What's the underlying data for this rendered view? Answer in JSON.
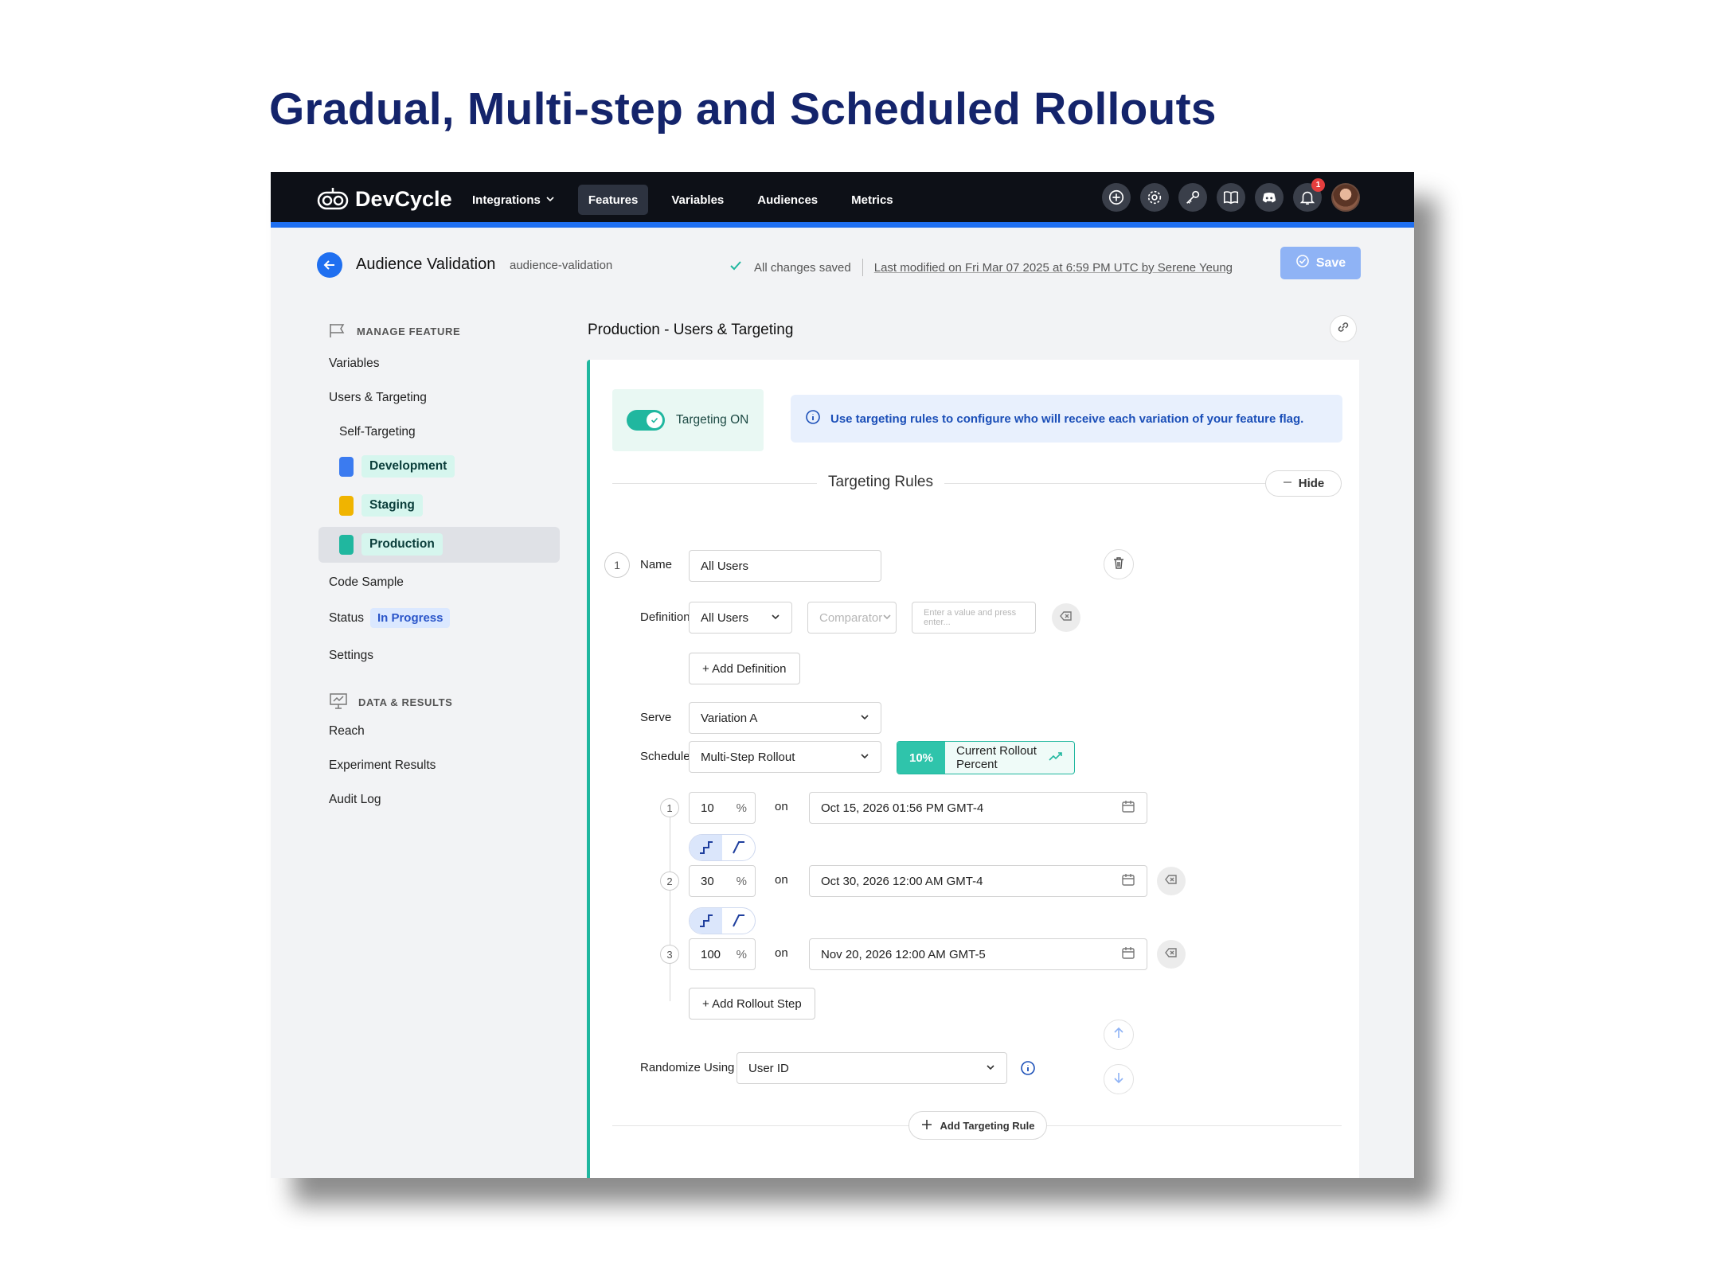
{
  "slide_title": "Gradual, Multi-step and Scheduled Rollouts",
  "app": {
    "logo_text": "DevCycle",
    "nav": [
      {
        "label": "Integrations",
        "active": false,
        "dropdown": true
      },
      {
        "label": "Features",
        "active": true
      },
      {
        "label": "Variables",
        "active": false
      },
      {
        "label": "Audiences",
        "active": false
      },
      {
        "label": "Metrics",
        "active": false
      }
    ],
    "top_icons": [
      "plus-circle-icon",
      "gear-icon",
      "key-icon",
      "book-icon",
      "discord-icon",
      "bell-icon"
    ],
    "notification_count": "1",
    "accent_color": "#1f6ff0",
    "brand_teal": "#20b79f"
  },
  "header": {
    "feature_name": "Audience Validation",
    "feature_key": "audience-validation",
    "saved_status": "All changes saved",
    "last_modified": "Last modified on Fri Mar 07 2025 at 6:59 PM UTC by Serene Yeung",
    "save_label": "Save"
  },
  "sidebar": {
    "manage_heading": "MANAGE FEATURE",
    "variables": "Variables",
    "users_targeting": "Users & Targeting",
    "self_targeting": "Self-Targeting",
    "environments": [
      {
        "label": "Development",
        "color": "#3b7bf0"
      },
      {
        "label": "Staging",
        "color": "#f0b400"
      },
      {
        "label": "Production",
        "color": "#20b79f"
      }
    ],
    "code_sample": "Code Sample",
    "status_label": "Status",
    "status_value": "In Progress",
    "settings": "Settings",
    "data_heading": "DATA & RESULTS",
    "reach": "Reach",
    "experiment_results": "Experiment Results",
    "audit_log": "Audit Log"
  },
  "main": {
    "title": "Production - Users & Targeting",
    "targeting_toggle": "Targeting ON",
    "info_banner": "Use targeting rules to configure who will receive each variation of your feature flag.",
    "rules_heading": "Targeting Rules",
    "hide_label": "Hide",
    "rule": {
      "number": "1",
      "name_label": "Name",
      "name_value": "All Users",
      "definition_label": "Definition",
      "definition_value": "All Users",
      "comparator_placeholder": "Comparator",
      "value_placeholder": "Enter a value and press enter...",
      "add_definition": "+ Add Definition",
      "serve_label": "Serve",
      "serve_value": "Variation A",
      "schedule_label": "Schedule",
      "schedule_value": "Multi-Step Rollout",
      "current_percent": "10%",
      "current_percent_label": "Current Rollout Percent",
      "steps": [
        {
          "n": "1",
          "percent": "10",
          "unit": "%",
          "on": "on",
          "date": "Oct 15, 2026 01:56 PM GMT-4"
        },
        {
          "n": "2",
          "percent": "30",
          "unit": "%",
          "on": "on",
          "date": "Oct 30, 2026 12:00 AM GMT-4"
        },
        {
          "n": "3",
          "percent": "100",
          "unit": "%",
          "on": "on",
          "date": "Nov 20, 2026 12:00 AM GMT-5"
        }
      ],
      "add_step": "+ Add Rollout Step",
      "randomize_label": "Randomize Using",
      "randomize_value": "User ID"
    },
    "add_rule": "Add Targeting Rule"
  }
}
